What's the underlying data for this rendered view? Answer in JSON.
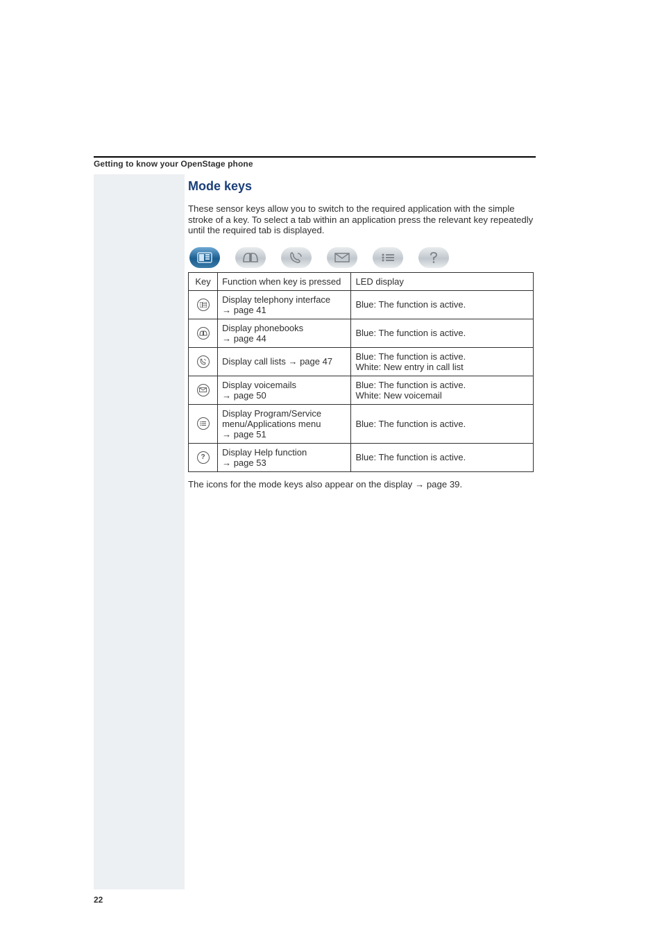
{
  "header": "Getting to know your OpenStage phone",
  "section_title": "Mode keys",
  "intro_text": "These sensor keys allow you to switch to the required application with the simple stroke of a key. To select a tab within an application press the relevant key repeatedly until the required tab is displayed.",
  "icon_row": [
    {
      "name": "telephony-icon",
      "active": true
    },
    {
      "name": "phonebook-icon",
      "active": false
    },
    {
      "name": "call-list-icon",
      "active": false
    },
    {
      "name": "voicemail-icon",
      "active": false
    },
    {
      "name": "menu-icon",
      "active": false
    },
    {
      "name": "help-icon",
      "active": false
    }
  ],
  "table": {
    "headers": {
      "key": "Key",
      "func": "Function when key is pressed",
      "led": "LED display"
    },
    "rows": [
      {
        "icon": "telephony-icon",
        "func_text": "Display telephony interface ",
        "page_ref": "page 41",
        "led": "Blue: The function is active."
      },
      {
        "icon": "phonebook-icon",
        "func_text": "Display phonebooks\n",
        "page_ref": "page 44",
        "led": "Blue: The function is active."
      },
      {
        "icon": "call-list-icon",
        "func_text": "Display call lists ",
        "page_ref": "page 47",
        "led": "Blue: The function is active.\nWhite: New entry in call list"
      },
      {
        "icon": "voicemail-icon",
        "func_text": "Display voicemails\n",
        "page_ref": "page 50",
        "led": "Blue: The function is active.\nWhite: New voicemail"
      },
      {
        "icon": "menu-icon",
        "func_text": "Display Program/Service menu/Applications menu\n",
        "page_ref": "page 51",
        "led": "Blue: The function is active."
      },
      {
        "icon": "help-icon",
        "func_text": "Display Help function\n",
        "page_ref": "page 53",
        "led": "Blue: The function is active."
      }
    ]
  },
  "footnote_prefix": "The icons for the mode keys also appear on the display ",
  "footnote_page": "page 39",
  "footnote_suffix": ".",
  "page_number": "22",
  "arrow_glyph": "→"
}
